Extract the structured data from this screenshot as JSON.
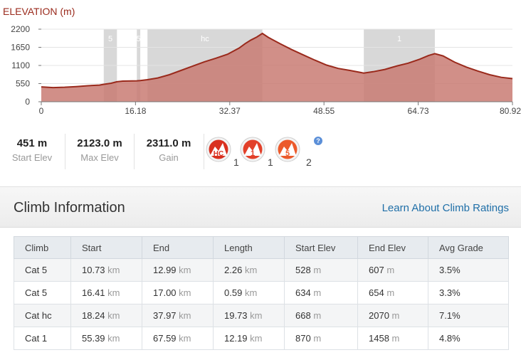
{
  "chart_data": {
    "type": "area",
    "title": "ELEVATION (m)",
    "xlabel": "",
    "ylabel": "",
    "xlim": [
      0,
      80.92
    ],
    "ylim": [
      0,
      2200
    ],
    "x_ticks": [
      "0",
      "16.18",
      "32.37",
      "48.55",
      "64.73",
      "80.92"
    ],
    "x_tick_values": [
      0,
      16.18,
      32.37,
      48.55,
      64.73,
      80.92
    ],
    "y_ticks": [
      "2200",
      "1650",
      "1100",
      "550",
      "0"
    ],
    "y_tick_values": [
      2200,
      1650,
      1100,
      550,
      0
    ],
    "grid": true,
    "colors": {
      "fill": "#c97b73",
      "line": "#9a2a1c",
      "highlight": "#d8d8d8"
    },
    "x": [
      0,
      2,
      4,
      6,
      8,
      10,
      10.73,
      12,
      12.99,
      14,
      16.41,
      17,
      18.24,
      20,
      22,
      24,
      26,
      28,
      30,
      32,
      34,
      35,
      36,
      37,
      37.97,
      39,
      41,
      43,
      45,
      47,
      49,
      51,
      53,
      55.39,
      57,
      59,
      61,
      63,
      65,
      66.5,
      67.59,
      69,
      71,
      73,
      75,
      77,
      79,
      80.92
    ],
    "y": [
      451,
      430,
      440,
      460,
      485,
      505,
      528,
      560,
      607,
      625,
      634,
      640,
      668,
      720,
      820,
      950,
      1080,
      1210,
      1320,
      1440,
      1630,
      1760,
      1870,
      1960,
      2070,
      1950,
      1760,
      1580,
      1420,
      1260,
      1110,
      1010,
      950,
      870,
      910,
      980,
      1080,
      1170,
      1290,
      1400,
      1458,
      1390,
      1200,
      1050,
      930,
      820,
      740,
      700
    ],
    "highlight_bands": [
      {
        "label": "5",
        "start": 10.73,
        "end": 12.99
      },
      {
        "label": "5",
        "start": 16.41,
        "end": 17.0
      },
      {
        "label": "hc",
        "start": 18.24,
        "end": 37.97
      },
      {
        "label": "1",
        "start": 55.39,
        "end": 67.59
      }
    ]
  },
  "stats": [
    {
      "value": "451 m",
      "label": "Start Elev"
    },
    {
      "value": "2123.0 m",
      "label": "Max Elev"
    },
    {
      "value": "2311.0 m",
      "label": "Gain"
    }
  ],
  "badges": [
    {
      "label": "HC",
      "count": "1",
      "icon": "climb-hc-icon"
    },
    {
      "label": "1",
      "count": "1",
      "icon": "climb-cat1-icon"
    },
    {
      "label": "5",
      "count": "2",
      "icon": "climb-cat5-icon"
    }
  ],
  "help_label": "?",
  "section": {
    "title": "Climb Information",
    "link": "Learn About Climb Ratings"
  },
  "table": {
    "headers": [
      "Climb",
      "Start",
      "End",
      "Length",
      "Start Elev",
      "End Elev",
      "Avg Grade"
    ],
    "rows": [
      {
        "climb": "Cat 5",
        "start": "10.73",
        "end": "12.99",
        "length": "2.26",
        "start_elev": "528",
        "end_elev": "607",
        "grade": "3.5%"
      },
      {
        "climb": "Cat 5",
        "start": "16.41",
        "end": "17.00",
        "length": "0.59",
        "start_elev": "634",
        "end_elev": "654",
        "grade": "3.3%"
      },
      {
        "climb": "Cat hc",
        "start": "18.24",
        "end": "37.97",
        "length": "19.73",
        "start_elev": "668",
        "end_elev": "2070",
        "grade": "7.1%"
      },
      {
        "climb": "Cat 1",
        "start": "55.39",
        "end": "67.59",
        "length": "12.19",
        "start_elev": "870",
        "end_elev": "1458",
        "grade": "4.8%"
      }
    ],
    "units": {
      "distance": "km",
      "elevation": "m"
    }
  }
}
